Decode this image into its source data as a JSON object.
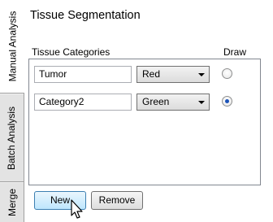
{
  "side_tabs": [
    {
      "label": "Manual Analysis",
      "active": true
    },
    {
      "label": "Batch Analysis",
      "active": false
    },
    {
      "label": "Merge",
      "active": false
    }
  ],
  "title": "Tissue Segmentation",
  "headers": {
    "categories": "Tissue Categories",
    "draw": "Draw"
  },
  "rows": [
    {
      "name": "Tumor",
      "color": "Red",
      "draw_selected": false
    },
    {
      "name": "Category2",
      "color": "Green",
      "draw_selected": true
    }
  ],
  "buttons": {
    "new": "New",
    "remove": "Remove"
  },
  "icons": {
    "combo": "dropdown-arrow-icon",
    "cursor": "mouse-pointer-icon"
  },
  "colors": {
    "accent": "#3c7fb1",
    "radio_dot": "#1b53b8"
  }
}
